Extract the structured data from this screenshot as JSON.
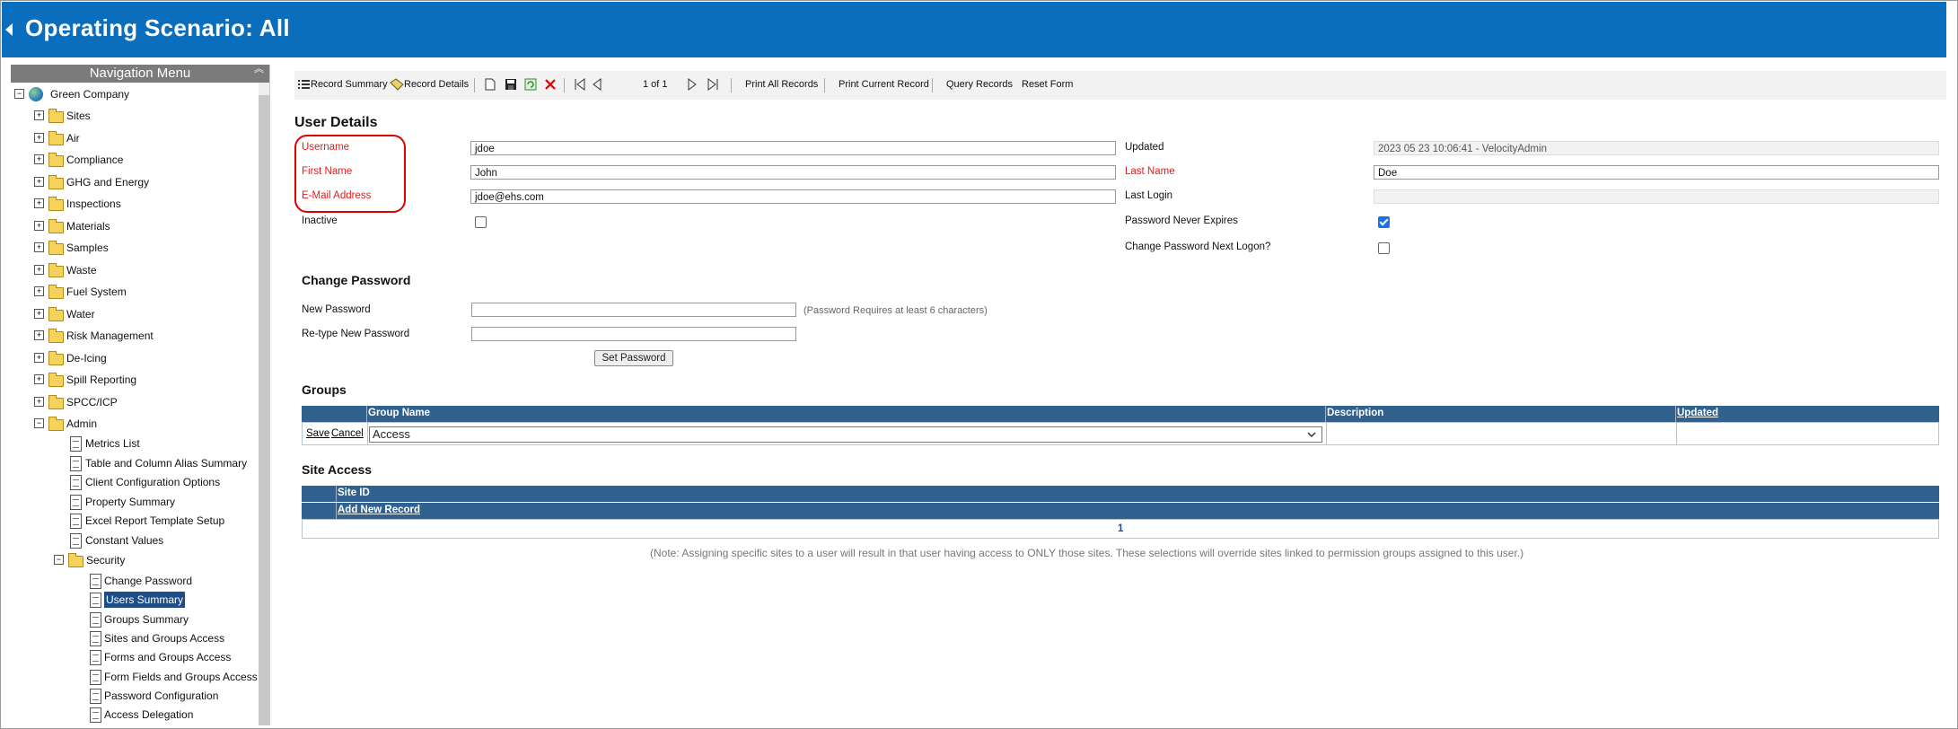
{
  "header": {
    "title": "Operating Scenario: All"
  },
  "nav": {
    "title": "Navigation Menu",
    "root": "Green Company",
    "folders": [
      "Sites",
      "Air",
      "Compliance",
      "GHG and Energy",
      "Inspections",
      "Materials",
      "Samples",
      "Waste",
      "Fuel System",
      "Water",
      "Risk Management",
      "De-Icing",
      "Spill Reporting",
      "SPCC/ICP",
      "Admin"
    ],
    "admin_items": [
      "Metrics List",
      "Table and Column Alias Summary",
      "Client Configuration Options",
      "Property Summary",
      "Excel Report Template Setup",
      "Constant Values"
    ],
    "security_folder": "Security",
    "security_items": [
      "Change Password",
      "Users Summary",
      "Groups Summary",
      "Sites and Groups Access",
      "Forms and Groups Access",
      "Form Fields and Groups Access",
      "Password Configuration",
      "Access Delegation"
    ],
    "selected": "Users Summary"
  },
  "toolbar": {
    "record_summary": "Record Summary",
    "record_details": "Record Details",
    "paging": "1 of 1",
    "print_all": "Print All Records",
    "print_current": "Print Current Record",
    "query": "Query Records",
    "reset": "Reset Form"
  },
  "user_details": {
    "heading": "User Details",
    "username_label": "Username",
    "username": "jdoe",
    "firstname_label": "First Name",
    "firstname": "John",
    "email_label": "E-Mail Address",
    "email": "jdoe@ehs.com",
    "inactive_label": "Inactive",
    "inactive": false,
    "updated_label": "Updated",
    "updated": "2023 05 23 10:06:41 - VelocityAdmin",
    "lastname_label": "Last Name",
    "lastname": "Doe",
    "lastlogin_label": "Last Login",
    "lastlogin": "",
    "never_expires_label": "Password Never Expires",
    "never_expires": true,
    "change_next_label": "Change Password Next Logon?",
    "change_next": false
  },
  "change_password": {
    "heading": "Change Password",
    "new_label": "New Password",
    "retype_label": "Re-type New Password",
    "hint": "(Password Requires at least 6 characters)",
    "button": "Set Password"
  },
  "groups": {
    "heading": "Groups",
    "columns": [
      "Group Name",
      "Description",
      "Updated"
    ],
    "save": "Save",
    "cancel": "Cancel",
    "selected_group": "Access"
  },
  "site_access": {
    "heading": "Site Access",
    "column": "Site ID",
    "add": "Add New Record",
    "page": "1",
    "note": "(Note: Assigning specific sites to a user will result in that user having access to ONLY those sites. These selections will override sites linked to permission groups assigned to this user.)"
  },
  "colors": {
    "header_bg": "#0a6ebd",
    "grid_header": "#31628f",
    "required": "#e02020",
    "highlight_box": "#e00000"
  }
}
